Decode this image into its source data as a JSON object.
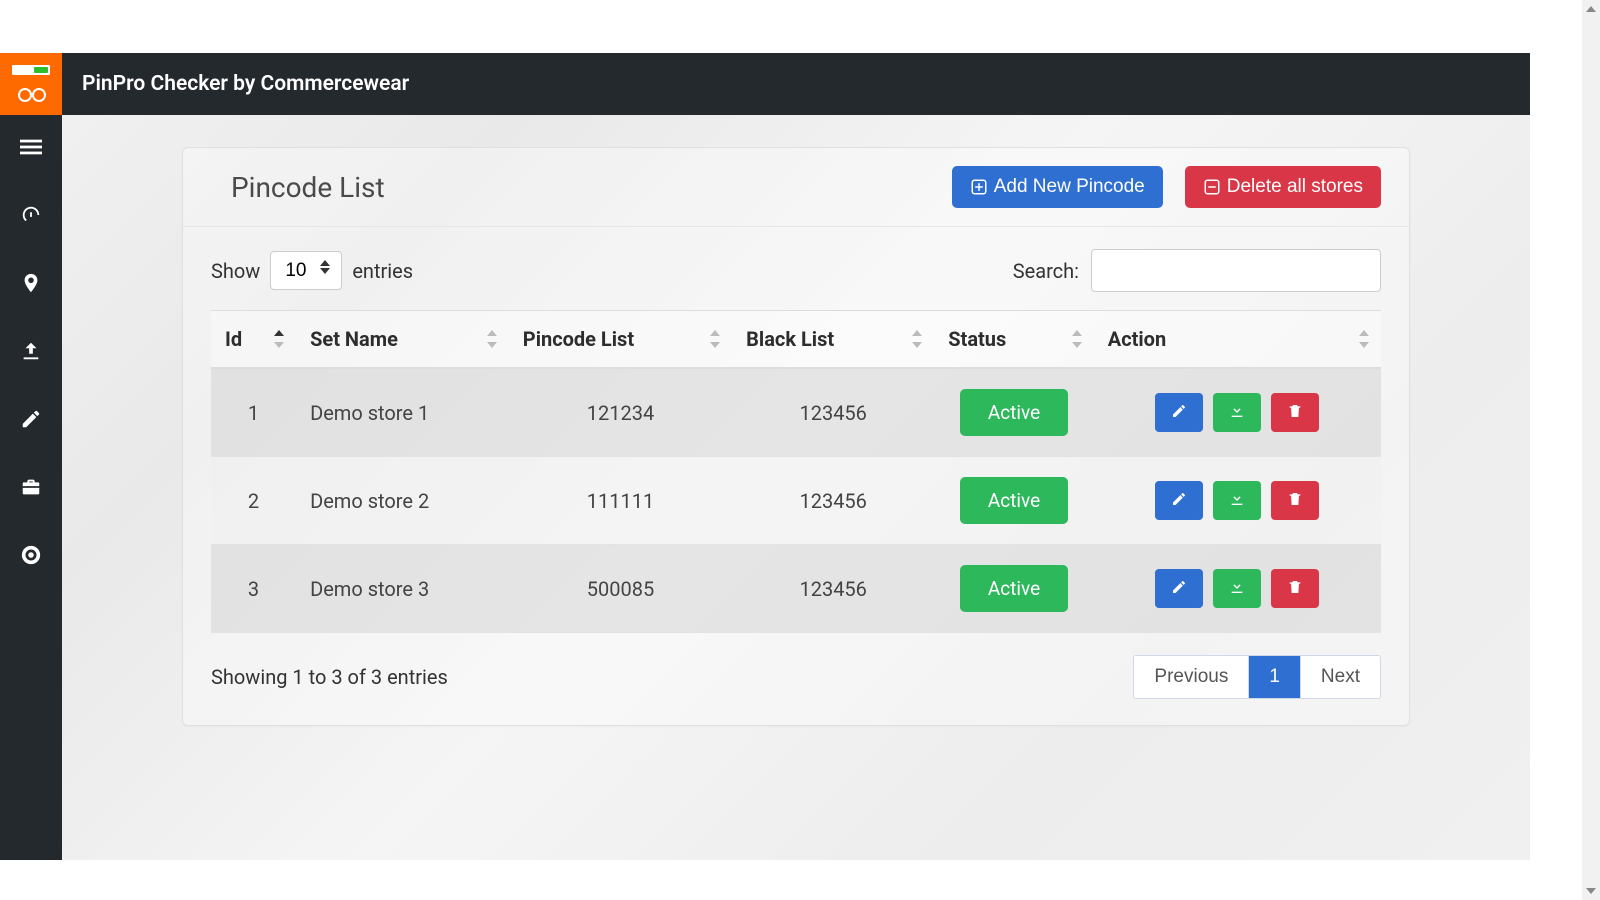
{
  "header": {
    "title": "PinPro Checker by Commercewear"
  },
  "card": {
    "title": "Pincode List",
    "actions": {
      "add": "Add New Pincode",
      "delete_all": "Delete all stores"
    }
  },
  "table": {
    "length": {
      "show": "Show",
      "value": "10",
      "entries": "entries"
    },
    "search": {
      "label": "Search:",
      "value": ""
    },
    "columns": [
      "Id",
      "Set Name",
      "Pincode List",
      "Black List",
      "Status",
      "Action"
    ],
    "rows": [
      {
        "id": "1",
        "set_name": "Demo store 1",
        "pincode": "121234",
        "blacklist": "123456",
        "status": "Active"
      },
      {
        "id": "2",
        "set_name": "Demo store 2",
        "pincode": "111111",
        "blacklist": "123456",
        "status": "Active"
      },
      {
        "id": "3",
        "set_name": "Demo store 3",
        "pincode": "500085",
        "blacklist": "123456",
        "status": "Active"
      }
    ],
    "info": "Showing 1 to 3 of 3 entries",
    "pagination": {
      "prev": "Previous",
      "pages": [
        "1"
      ],
      "next": "Next"
    }
  },
  "colors": {
    "primary": "#2f6fd1",
    "danger": "#d93747",
    "success": "#2eb85c",
    "dark": "#24292e",
    "accent": "#ff6a00"
  }
}
